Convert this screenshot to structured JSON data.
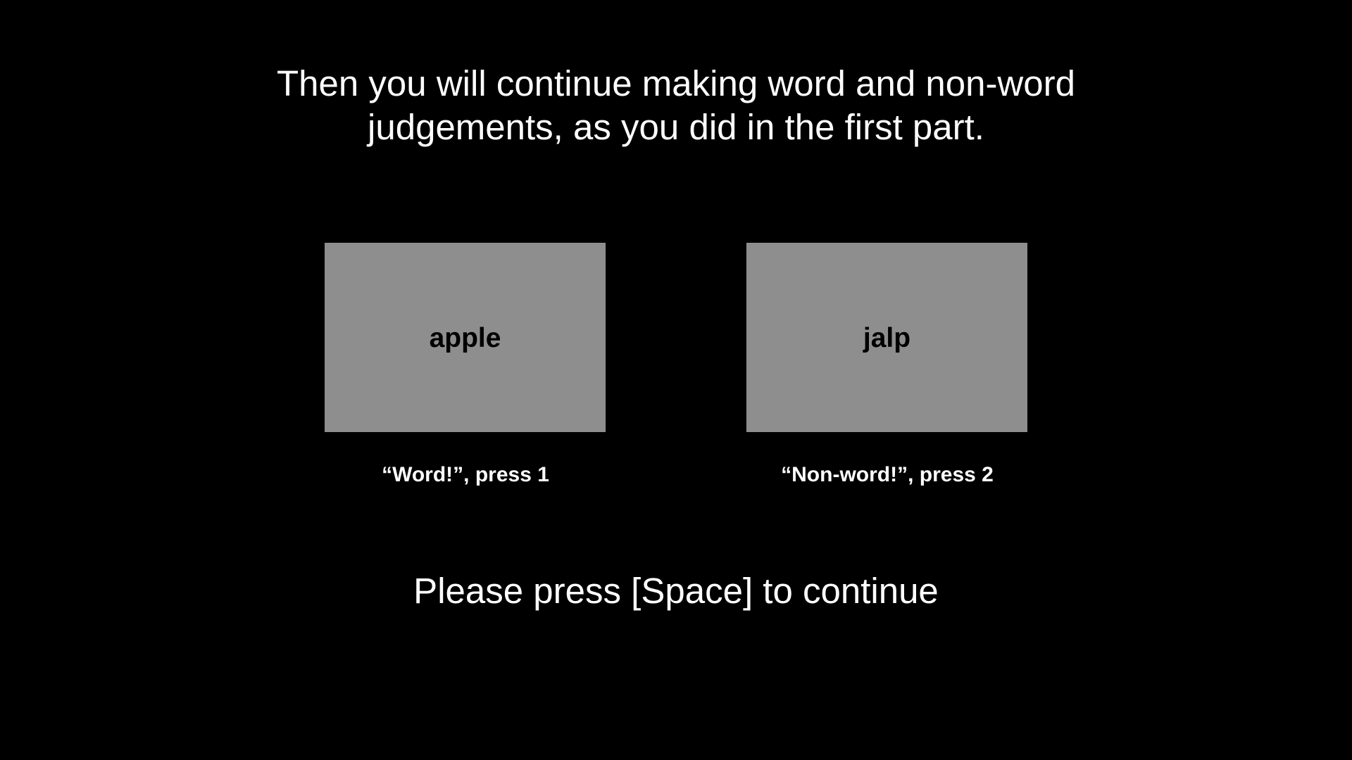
{
  "colors": {
    "background": "#000000",
    "text": "#ffffff",
    "stimulus_box": "#8e8e8e",
    "stimulus_text": "#000000"
  },
  "instruction": {
    "line1": "Then you will continue making word and non-word",
    "line2": "judgements, as you did in the first part."
  },
  "examples": {
    "word": {
      "stimulus": "apple",
      "response_label": "“Word!”, press 1"
    },
    "nonword": {
      "stimulus": "jalp",
      "response_label": "“Non-word!”, press 2"
    }
  },
  "continue_prompt": "Please press [Space] to continue"
}
